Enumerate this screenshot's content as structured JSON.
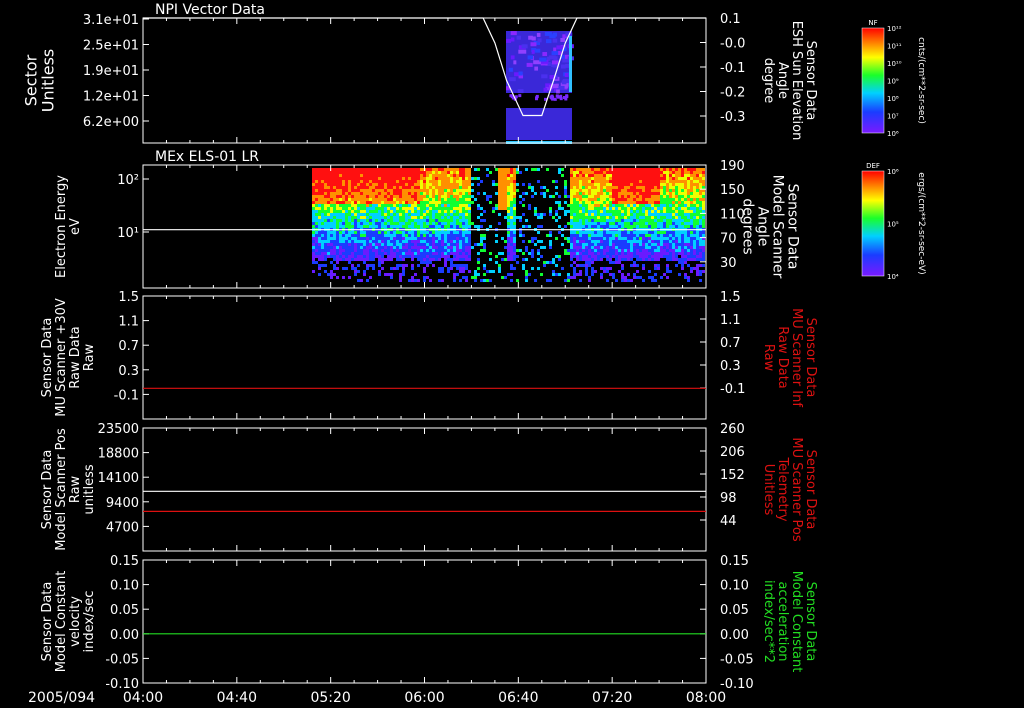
{
  "date_label": "2005/094",
  "x_ticks": [
    "04:00",
    "04:40",
    "05:20",
    "06:00",
    "06:40",
    "07:20",
    "08:00"
  ],
  "colors": {
    "white": "#ffffff",
    "red": "#dd1111",
    "green": "#22dd22"
  },
  "colorbars": [
    {
      "title": "NF",
      "unit": "cnts/(cm**2-sr-sec)",
      "ticks": [
        "10¹²",
        "10¹¹",
        "10¹⁰",
        "10⁹",
        "10⁸",
        "10⁷",
        "10⁶"
      ]
    },
    {
      "title": "DEF",
      "unit": "ergs/(cm**2-sr-sec-eV)",
      "ticks": [
        "10⁶",
        "10⁵",
        "10⁴"
      ]
    }
  ],
  "chart_data": [
    {
      "type": "heatmap",
      "title": "NPI Vector Data",
      "ylabel_lines": [
        "Sector",
        "Unitless"
      ],
      "y_ticks": [
        "3.1e+01",
        "2.5e+01",
        "1.9e+01",
        "1.2e+01",
        "6.2e+00"
      ],
      "y2label_lines": [
        "Sensor Data",
        "ESH Sun Elevation",
        "Angle",
        "degree"
      ],
      "y2_ticks": [
        "0.1",
        "-0.0",
        "-0.1",
        "-0.2",
        "-0.3"
      ],
      "y2lim": [
        -0.4,
        0.1
      ],
      "series": [
        {
          "name": "Sensor Data ESH Sun Elevation Angle",
          "color": "white",
          "x": [
            "04:00",
            "06:25",
            "06:30",
            "06:35",
            "06:42",
            "06:50",
            "06:55",
            "07:00",
            "07:05",
            "08:00"
          ],
          "y": [
            0.1,
            0.1,
            0.0,
            -0.15,
            -0.29,
            -0.29,
            -0.15,
            0.0,
            0.1,
            0.1
          ]
        }
      ]
    },
    {
      "type": "heatmap",
      "title": "MEx ELS-01 LR",
      "ylabel_lines": [
        "Electron Energy",
        "eV"
      ],
      "y_ticks": [
        "10²",
        "10¹"
      ],
      "y2label_lines": [
        "Sensor Data",
        "Model Scanner",
        "Angle",
        "degrees"
      ],
      "y2_ticks": [
        "190",
        "150",
        "110",
        "70",
        "30"
      ],
      "y2lim": [
        0,
        190
      ],
      "series": [
        {
          "name": "Sensor Data Model Scanner Angle",
          "color": "white",
          "x": [
            "04:00",
            "08:00"
          ],
          "y": [
            90,
            90
          ]
        }
      ]
    },
    {
      "type": "line",
      "ylabel_lines": [
        "Sensor Data",
        "MU Scanner +30V",
        "Raw Data",
        "Raw"
      ],
      "y_ticks": [
        "1.5",
        "1.1",
        "0.7",
        "0.3",
        "-0.1"
      ],
      "ylim": [
        -0.5,
        1.5
      ],
      "y2label_lines": [
        "Sensor Data",
        "MU Scanner Inf",
        "Raw Data",
        "Raw"
      ],
      "y2_ticks": [
        "1.5",
        "1.1",
        "0.7",
        "0.3",
        "-0.1"
      ],
      "series": [
        {
          "name": "Sensor Data MU Scanner Inf Raw Data",
          "color": "red",
          "x": [
            "04:00",
            "08:00"
          ],
          "y": [
            0.0,
            0.0
          ]
        }
      ]
    },
    {
      "type": "line",
      "ylabel_lines": [
        "Sensor Data",
        "Model Scanner Pos",
        "Raw",
        "unitless"
      ],
      "y_ticks": [
        "23500",
        "18800",
        "14100",
        "9400",
        "4700"
      ],
      "ylim": [
        0,
        23500
      ],
      "y2label_lines": [
        "Sensor Data",
        "MU Scanner Pos",
        "Telemetry",
        "Unitless"
      ],
      "y2_ticks": [
        "260",
        "206",
        "152",
        "98",
        "44"
      ],
      "y2lim": [
        -10,
        260
      ],
      "series": [
        {
          "name": "Sensor Data Model Scanner Pos Raw",
          "color": "white",
          "x": [
            "04:00",
            "08:00"
          ],
          "y": [
            11400,
            11400
          ]
        },
        {
          "name": "Sensor Data MU Scanner Pos Telemetry",
          "color": "red",
          "x": [
            "04:00",
            "08:00"
          ],
          "y": [
            77,
            77
          ]
        }
      ]
    },
    {
      "type": "line",
      "ylabel_lines": [
        "Sensor Data",
        "Model Constant",
        "velocity",
        "index/sec"
      ],
      "y_ticks": [
        "0.15",
        "0.10",
        "0.05",
        "0.00",
        "-0.05",
        "-0.10"
      ],
      "ylim": [
        -0.1,
        0.15
      ],
      "y2label_lines": [
        "Sensor Data",
        "Model Constant",
        "acceleration",
        "index/sec**2"
      ],
      "y2_ticks": [
        "0.15",
        "0.10",
        "0.05",
        "0.00",
        "-0.05",
        "-0.10"
      ],
      "series": [
        {
          "name": "Sensor Data Model Constant acceleration",
          "color": "green",
          "x": [
            "04:00",
            "08:00"
          ],
          "y": [
            0.0,
            0.0
          ]
        }
      ]
    }
  ]
}
